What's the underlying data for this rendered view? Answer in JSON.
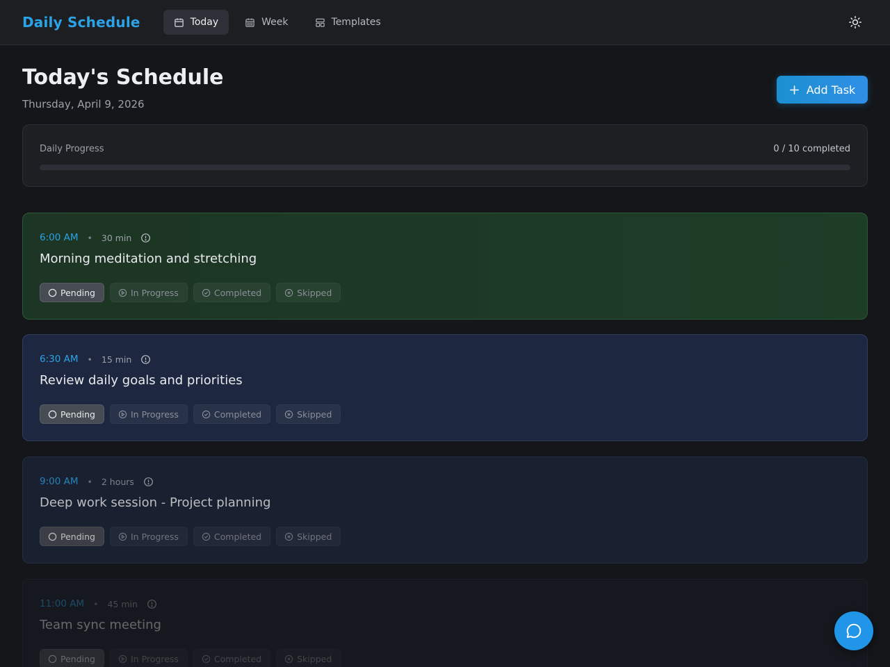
{
  "header": {
    "brand": "Daily Schedule",
    "nav": [
      {
        "label": "Today",
        "icon": "calendar-icon",
        "active": true
      },
      {
        "label": "Week",
        "icon": "calendar-grid-icon",
        "active": false
      },
      {
        "label": "Templates",
        "icon": "layout-icon",
        "active": false
      }
    ],
    "theme_toggle_icon": "sun-icon"
  },
  "page": {
    "title": "Today's Schedule",
    "date": "Thursday, April 9, 2026",
    "add_button_label": "Add Task"
  },
  "progress": {
    "label": "Daily Progress",
    "completed_text": "0 / 10 completed",
    "completed": 0,
    "total": 10,
    "fraction": 0
  },
  "status_labels": [
    "Pending",
    "In Progress",
    "Completed",
    "Skipped"
  ],
  "tasks": [
    {
      "time": "6:00 AM",
      "duration": "30 min",
      "title": "Morning meditation and stretching",
      "status": "Pending"
    },
    {
      "time": "6:30 AM",
      "duration": "15 min",
      "title": "Review daily goals and priorities",
      "status": "Pending"
    },
    {
      "time": "9:00 AM",
      "duration": "2 hours",
      "title": "Deep work session - Project planning",
      "status": "Pending"
    },
    {
      "time": "11:00 AM",
      "duration": "45 min",
      "title": "Team sync meeting",
      "status": "Pending"
    }
  ],
  "colors": {
    "accent": "#2ba3e6",
    "background": "#141619",
    "task_green": "#1d3d27",
    "task_blue": "#1d2740"
  },
  "fab_icon": "chat-bubble-icon"
}
